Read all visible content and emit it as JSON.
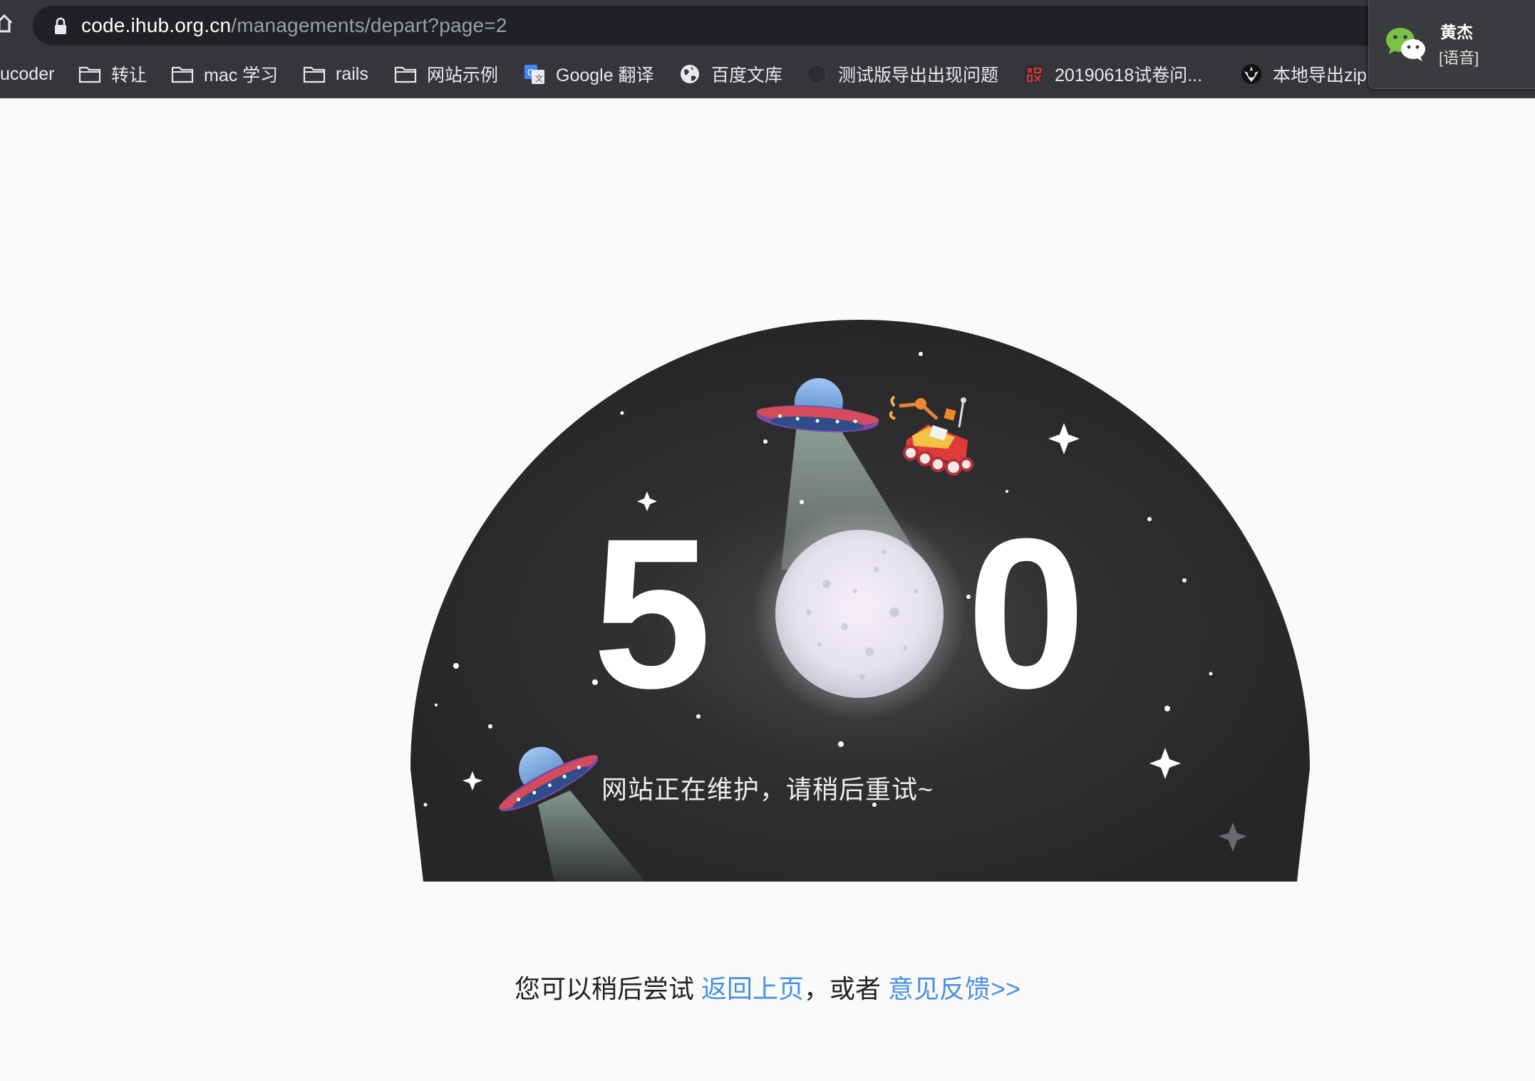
{
  "browser": {
    "url_host": "code.ihub.org.cn",
    "url_path": "/managements/depart?page=2",
    "bookmarks": [
      {
        "label": "ucoder",
        "icon": "none"
      },
      {
        "label": "转让",
        "icon": "folder-icon"
      },
      {
        "label": "mac 学习",
        "icon": "folder-icon"
      },
      {
        "label": "rails",
        "icon": "folder-icon"
      },
      {
        "label": "网站示例",
        "icon": "folder-icon"
      },
      {
        "label": "Google 翻译",
        "icon": "google-translate-icon"
      },
      {
        "label": "百度文库",
        "icon": "globe-icon"
      },
      {
        "label": "测试版导出出现问题",
        "icon": "circle-icon"
      },
      {
        "label": "20190618试卷问...",
        "icon": "site-favicon-icon"
      },
      {
        "label": "本地导出zip",
        "icon": "rebel-icon"
      }
    ]
  },
  "notification": {
    "app_icon": "wechat-icon",
    "sender": "黄杰",
    "message": "[语音]"
  },
  "error_page": {
    "code_left": "5",
    "code_right": "0",
    "message": "网站正在维护，请稍后重试~",
    "footer_prefix": "您可以稍后尝试 ",
    "back_link": "返回上页",
    "footer_middle": "，或者  ",
    "feedback_link": "意见反馈>>"
  },
  "colors": {
    "dome": "#2a2a2c",
    "link": "#4a90e2",
    "chrome_bg": "#35363a"
  }
}
